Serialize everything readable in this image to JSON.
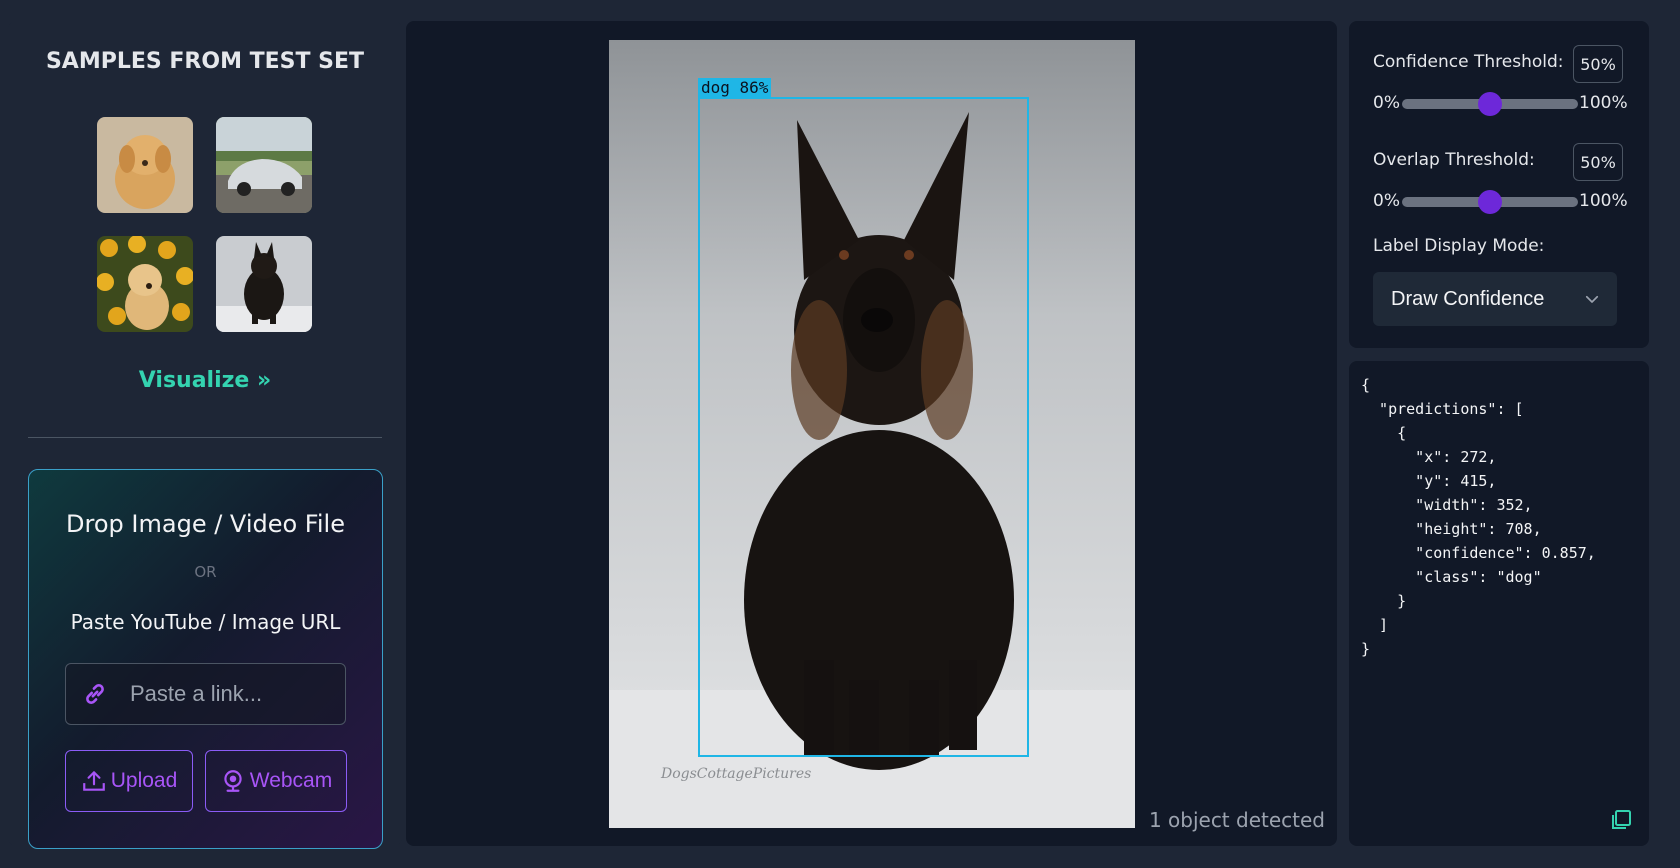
{
  "sidebar": {
    "title": "SAMPLES FROM TEST SET",
    "visualize_label": "Visualize »",
    "samples": [
      {
        "name": "golden-retriever-puppy"
      },
      {
        "name": "silver-car"
      },
      {
        "name": "puppy-in-sunflowers"
      },
      {
        "name": "black-dog-in-snow"
      }
    ],
    "dropzone": {
      "title": "Drop Image / Video File",
      "or": "OR",
      "paste_label": "Paste YouTube / Image URL",
      "url_placeholder": "Paste a link...",
      "upload_label": "Upload",
      "webcam_label": "Webcam"
    }
  },
  "viewer": {
    "bbox_label": "dog 86%",
    "image_watermark": "DogsCottagePictures",
    "status": "1 object detected",
    "bbox_color": "#1fb6e6"
  },
  "controls": {
    "confidence_label": "Confidence Threshold:",
    "confidence_value": "50%",
    "confidence_fraction": 0.5,
    "overlap_label": "Overlap Threshold:",
    "overlap_value": "50%",
    "overlap_fraction": 0.5,
    "range_min": "0%",
    "range_max": "100%",
    "label_mode_label": "Label Display Mode:",
    "label_mode_value": "Draw Confidence"
  },
  "json_output": "{\n  \"predictions\": [\n    {\n      \"x\": 272,\n      \"y\": 415,\n      \"width\": 352,\n      \"height\": 708,\n      \"confidence\": 0.857,\n      \"class\": \"dog\"\n    }\n  ]\n}",
  "colors": {
    "accent_teal": "#34d3b0",
    "accent_purple": "#a855f7",
    "slider_knob": "#6d28d9",
    "panel_bg": "#111827",
    "page_bg": "#1e2636"
  }
}
